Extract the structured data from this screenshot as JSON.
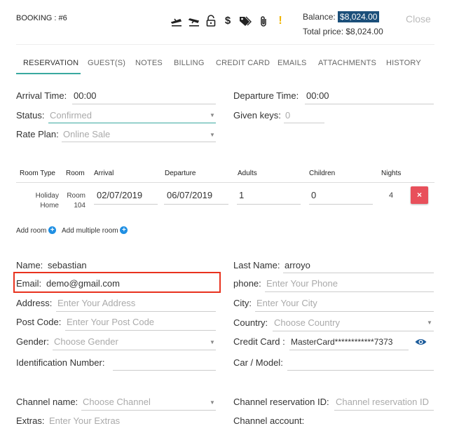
{
  "header": {
    "booking_label": "BOOKING : #6",
    "balance_label": "Balance:",
    "balance_value": "$8,024.00",
    "total_label": "Total price: $8,024.00",
    "close_label": "Close",
    "icons": [
      "check-in-icon",
      "check-out-icon",
      "lock-icon",
      "dollar-icon",
      "tags-icon",
      "paperclip-icon",
      "alert-icon"
    ],
    "alert_glyph": "!",
    "dollar_glyph": "$"
  },
  "tabs": [
    "RESERVATION",
    "GUEST(S)",
    "NOTES",
    "BILLING",
    "CREDIT CARD",
    "EMAILS",
    "ATTACHMENTS",
    "HISTORY"
  ],
  "active_tab": "RESERVATION",
  "reservation": {
    "arrival_label": "Arrival Time:",
    "arrival_value": "00:00",
    "departure_label": "Departure Time:",
    "departure_value": "00:00",
    "status_label": "Status:",
    "status_value": "Confirmed",
    "given_keys_label": "Given keys:",
    "given_keys_value": "0",
    "rate_plan_label": "Rate Plan:",
    "rate_plan_value": "Online Sale"
  },
  "rooms_table": {
    "headers": [
      "Room Type",
      "Room",
      "Arrival",
      "Departure",
      "Adults",
      "Children",
      "Nights"
    ],
    "row": {
      "room_type_line1": "Holiday",
      "room_type_line2": "Home",
      "room_line1": "Room",
      "room_line2": "104",
      "arrival": "02/07/2019",
      "departure": "06/07/2019",
      "adults": "1",
      "children": "0",
      "nights": "4",
      "delete_glyph": "×"
    },
    "add_room_label": "Add room",
    "add_multiple_label": "Add multiple room",
    "plus_glyph": "+"
  },
  "guest": {
    "name_label": "Name:",
    "name_value": "sebastian",
    "last_name_label": "Last Name:",
    "last_name_value": "arroyo",
    "email_label": "Email:",
    "email_value": "demo@gmail.com",
    "phone_label": "phone:",
    "phone_placeholder": "Enter Your Phone",
    "address_label": "Address:",
    "address_placeholder": "Enter Your Address",
    "city_label": "City:",
    "city_placeholder": "Enter Your City",
    "post_code_label": "Post Code:",
    "post_code_placeholder": "Enter Your Post Code",
    "country_label": "Country:",
    "country_placeholder": "Choose Country",
    "gender_label": "Gender:",
    "gender_placeholder": "Choose Gender",
    "credit_card_label": "Credit Card :",
    "credit_card_value": "MasterCard************7373",
    "id_number_label": "Identification Number:",
    "car_model_label": "Car / Model:",
    "channel_name_label": "Channel name:",
    "channel_name_placeholder": "Choose Channel",
    "channel_res_id_label": "Channel reservation ID:",
    "channel_res_id_placeholder": "Channel reservation ID",
    "extras_label": "Extras:",
    "extras_placeholder": "Enter Your Extras",
    "channel_account_label": "Channel account:"
  },
  "colors": {
    "accent_teal": "#3aa9a0",
    "balance_badge": "#1b4f7a",
    "delete_button": "#e8505b",
    "highlight_box": "#e8321e",
    "plus_icon": "#1f8fe3",
    "alert_icon": "#f0b400"
  }
}
